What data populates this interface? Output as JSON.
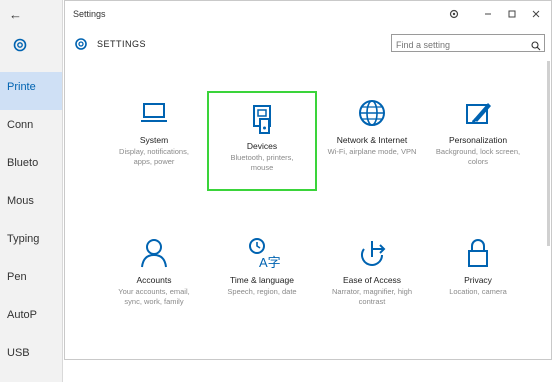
{
  "background_window": {
    "items": [
      {
        "label": "Printe",
        "active": true
      },
      {
        "label": "Conn",
        "active": false
      },
      {
        "label": "Blueto",
        "active": false
      },
      {
        "label": "Mous",
        "active": false
      },
      {
        "label": "Typing",
        "active": false
      },
      {
        "label": "Pen",
        "active": false
      },
      {
        "label": "AutoP",
        "active": false
      },
      {
        "label": "USB",
        "active": false
      }
    ]
  },
  "window": {
    "title": "Settings",
    "controls": {
      "settings": "gear-icon",
      "minimize": "minimize-icon",
      "maximize": "maximize-icon",
      "close": "close-icon"
    }
  },
  "header": {
    "title": "SETTINGS",
    "search_placeholder": "Find a setting"
  },
  "tiles": [
    {
      "name": "System",
      "desc": "Display, notifications, apps, power",
      "icon": "laptop-icon"
    },
    {
      "name": "Devices",
      "desc": "Bluetooth, printers, mouse",
      "icon": "devices-icon",
      "selected": true
    },
    {
      "name": "Network & Internet",
      "desc": "Wi-Fi, airplane mode, VPN",
      "icon": "globe-icon"
    },
    {
      "name": "Personalization",
      "desc": "Background, lock screen, colors",
      "icon": "paintbrush-icon"
    },
    {
      "name": "Accounts",
      "desc": "Your accounts, email, sync, work, family",
      "icon": "person-icon"
    },
    {
      "name": "Time & language",
      "desc": "Speech, region, date",
      "icon": "time-language-icon"
    },
    {
      "name": "Ease of Access",
      "desc": "Narrator, magnifier, high contrast",
      "icon": "ease-of-access-icon"
    },
    {
      "name": "Privacy",
      "desc": "Location, camera",
      "icon": "lock-icon"
    }
  ],
  "colors": {
    "accent": "#0063b1",
    "selection_border": "#3ad43a"
  }
}
